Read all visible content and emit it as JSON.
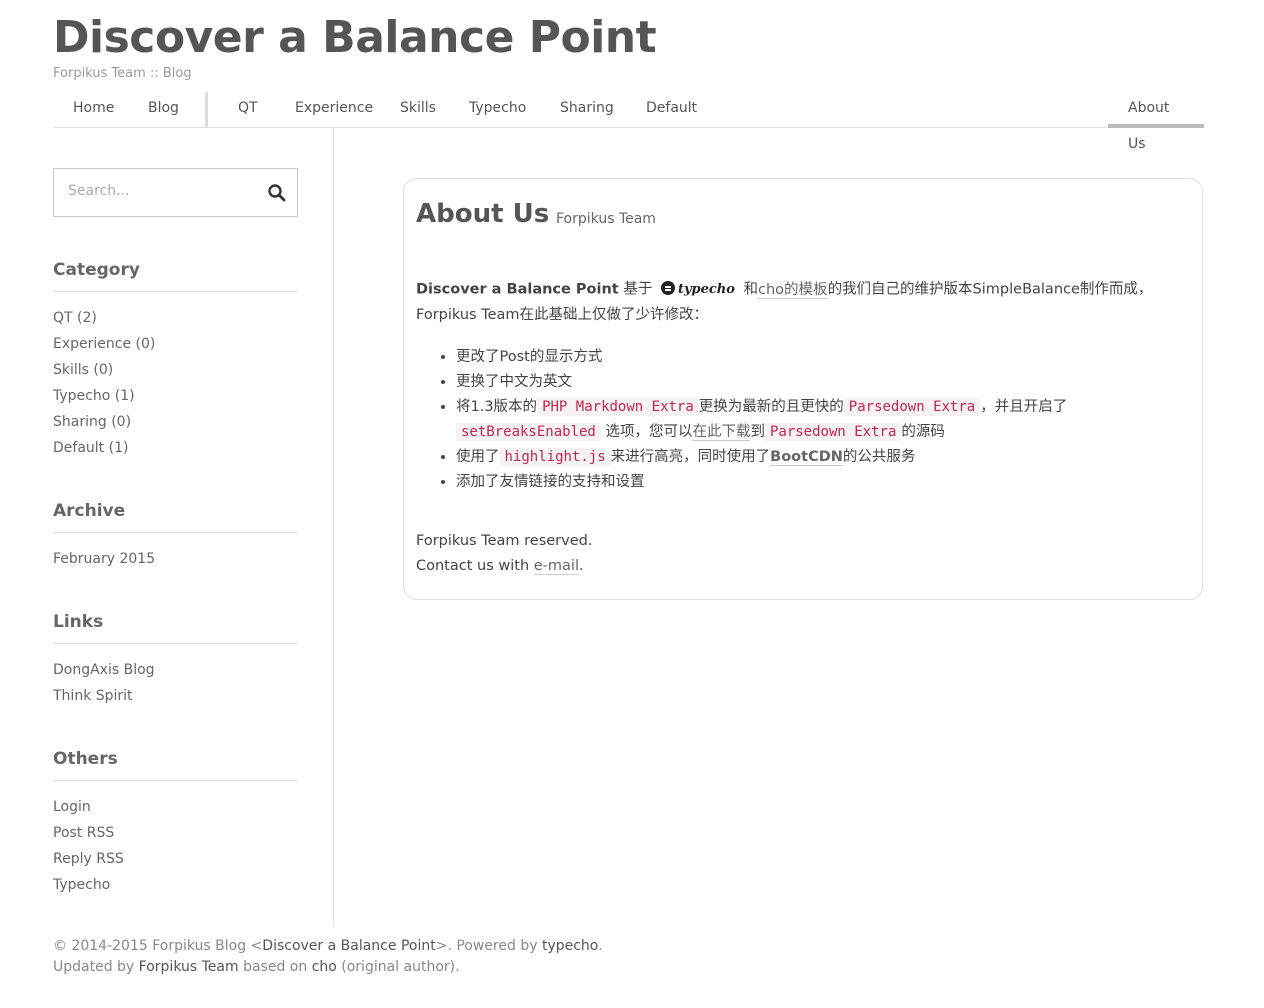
{
  "site": {
    "title": "Discover a Balance Point",
    "description": "Forpikus Team :: Blog"
  },
  "nav": {
    "items": [
      {
        "label": "Home"
      },
      {
        "label": "Blog"
      },
      {
        "label": "QT"
      },
      {
        "label": "Experience"
      },
      {
        "label": "Skills"
      },
      {
        "label": "Typecho"
      },
      {
        "label": "Sharing"
      },
      {
        "label": "Default"
      }
    ],
    "active": {
      "label": "About Us"
    }
  },
  "search": {
    "placeholder": "Search..."
  },
  "sidebar": {
    "category": {
      "title": "Category",
      "items": [
        "QT (2)",
        "Experience (0)",
        "Skills (0)",
        "Typecho (1)",
        "Sharing (0)",
        "Default (1)"
      ]
    },
    "archive": {
      "title": "Archive",
      "items": [
        "February 2015"
      ]
    },
    "links": {
      "title": "Links",
      "items": [
        "DongAxis Blog",
        "Think Spirit"
      ]
    },
    "others": {
      "title": "Others",
      "items": [
        "Login",
        "Post RSS",
        "Reply RSS",
        "Typecho"
      ]
    }
  },
  "post": {
    "title": "About Us",
    "author": "Forpikus Team",
    "intro": {
      "brand": "Discover a Balance Point",
      "based_on": "基于",
      "logo_text": "typecho",
      "and": "和",
      "cho_link": "cho的模板",
      "rest1": "的我们自己的维护版本SimpleBalance制作而成，Forpikus Team在此基础上仅做了少许修改："
    },
    "changes": {
      "c1": "更改了Post的显示方式",
      "c2": "更换了中文为英文",
      "c3a": "将1.3版本的",
      "c3code1": "PHP Markdown Extra",
      "c3b": "更换为最新的且更快的",
      "c3code2": "Parsedown Extra",
      "c3c": "，并且开启了",
      "c3code3": "setBreaksEnabled",
      "c3d": "选项，您可以",
      "c3link": "在此下载",
      "c3e": "到",
      "c3code4": "Parsedown Extra",
      "c3f": "的源码",
      "c4a": "使用了",
      "c4code": "highlight.js",
      "c4b": "来进行高亮，同时使用了",
      "c4link": "BootCDN",
      "c4c": "的公共服务",
      "c5": "添加了友情链接的支持和设置"
    },
    "footer_line1": "Forpikus Team reserved.",
    "footer_line2_prefix": "Contact us with ",
    "footer_email_link": "e-mail",
    "footer_line2_suffix": "."
  },
  "footer": {
    "p1": "© 2014-2015 Forpikus Blog <",
    "p1_link": "Discover a Balance Point",
    "p2": ">. Powered by ",
    "p2_link": "typecho",
    "p3": ".",
    "p4": "Updated by ",
    "p4_link": "Forpikus Team",
    "p5": " based on ",
    "p5_link": "cho",
    "p6": " (original author)."
  }
}
